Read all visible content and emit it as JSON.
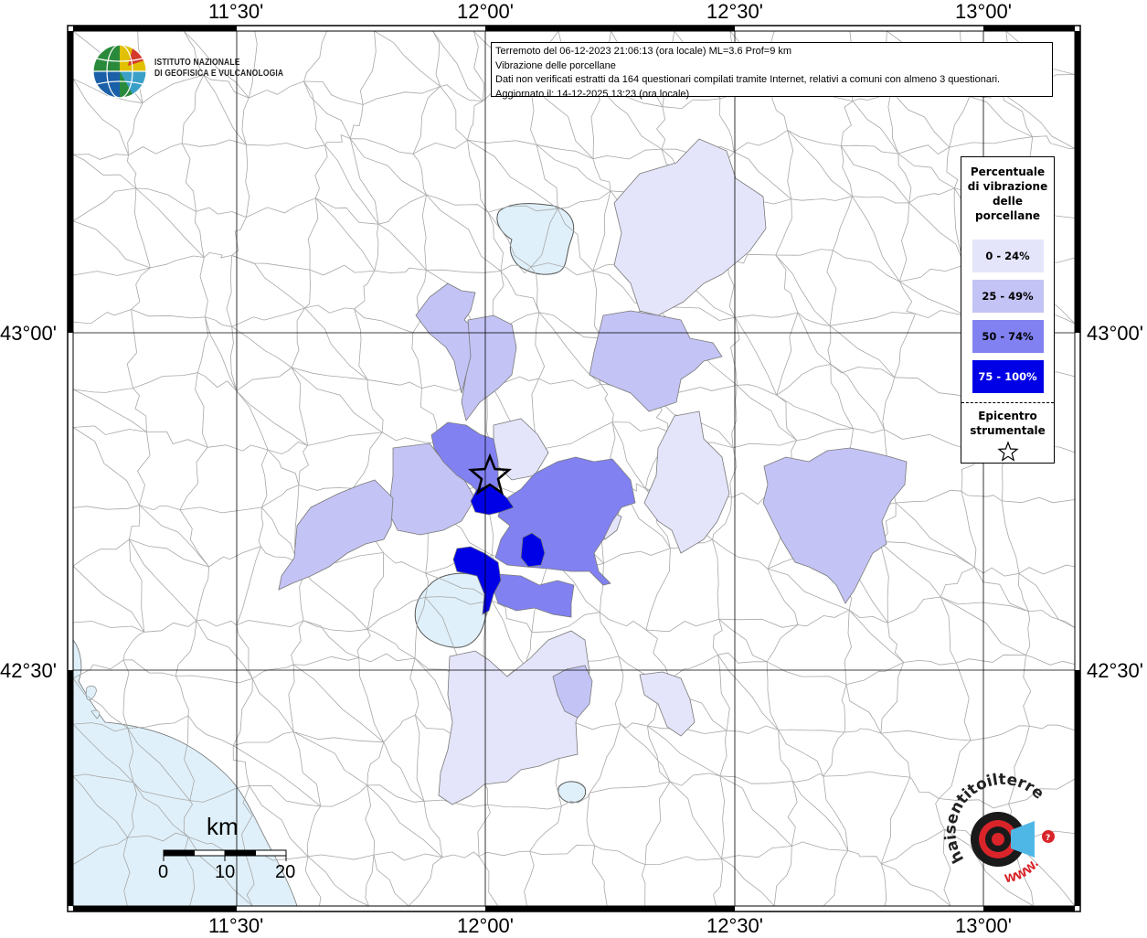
{
  "frame": {
    "top_labels": [
      "11°30'",
      "12°00'",
      "12°30'",
      "13°00'"
    ],
    "bottom_labels": [
      "11°30'",
      "12°00'",
      "12°30'",
      "13°00'"
    ],
    "left_labels": [
      "43°00'",
      "42°30'"
    ],
    "right_labels": [
      "43°00'",
      "42°30'"
    ]
  },
  "institute": {
    "line1": "ISTITUTO NAZIONALE",
    "line2": "DI GEOFISICA E VULCANOLOGIA"
  },
  "info": {
    "line1": "Terremoto del 06-12-2023 21:06:13 (ora locale) ML=3.6 Prof=9 km",
    "line2": "Vibrazione delle porcellane",
    "line3": "Dati non verificati estratti da 164 questionari compilati tramite Internet, relativi a comuni con almeno 3 questionari.",
    "line4": "Aggiornato il: 14-12-2025 13:23 (ora locale)"
  },
  "legend": {
    "title_lines": [
      "Percentuale",
      "di vibrazione",
      "delle",
      "porcellane"
    ],
    "classes": [
      {
        "label": "0 - 24%",
        "color": "#e4e4fa"
      },
      {
        "label": "25 - 49%",
        "color": "#c3c3f5"
      },
      {
        "label": "50 - 74%",
        "color": "#8181f2"
      },
      {
        "label": "75 - 100%",
        "color": "#0000e6"
      }
    ],
    "epicenter_lines": [
      "Epicentro",
      "strumentale"
    ]
  },
  "scalebar": {
    "unit": "km",
    "ticks": [
      "0",
      "10",
      "20"
    ]
  },
  "watermark": {
    "text_top": "haisentitoilterremoto.it",
    "text_bottom": "WWW."
  },
  "colors": {
    "water": "#dff0fa",
    "boundary": "#9a9a9a",
    "frame": "#000000"
  }
}
